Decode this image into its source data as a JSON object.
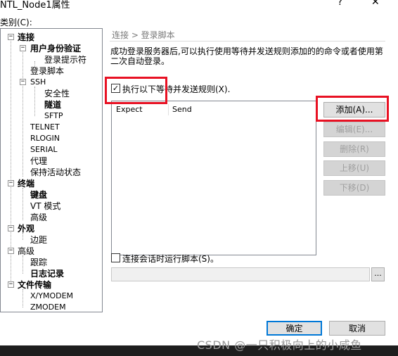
{
  "window": {
    "title": "NTL_Node1属性",
    "help_glyph": "?",
    "close_glyph": "✕"
  },
  "category_label": "类别(C):",
  "tree": {
    "connection": "连接",
    "auth": "用户身份验证",
    "login_prompt": "登录提示符",
    "login_script": "登录脚本",
    "ssh": "SSH",
    "security": "安全性",
    "tunnel": "隧道",
    "sftp": "SFTP",
    "telnet": "TELNET",
    "rlogin": "RLOGIN",
    "serial": "SERIAL",
    "proxy": "代理",
    "keepalive": "保持活动状态",
    "terminal": "终端",
    "keyboard": "键盘",
    "vt_mode": "VT 模式",
    "advanced_term": "高级",
    "appearance": "外观",
    "margin": "边距",
    "advanced": "高级",
    "trace": "跟踪",
    "logging": "日志记录",
    "file_transfer": "文件传输",
    "xymodem": "X/YMODEM",
    "zmodem": "ZMODEM"
  },
  "panel": {
    "header": "连接 > 登录脚本",
    "description": "成功登录服务器后,可以执行使用等待并发送规则添加的的命令或者使用第二次自动登录。",
    "rules_checkbox_label": "执行以下等待并发送规则(X).",
    "rules_checked": true,
    "col_expect": "Expect",
    "col_send": "Send",
    "add_button": "添加(A)...",
    "edit_button": "编辑(E)...",
    "delete_button": "删除(R)",
    "up_button": "上移(U)",
    "down_button": "下移(D)",
    "script_checkbox_label": "连接会话时运行脚本(S)。",
    "script_checked": false,
    "script_path_value": "",
    "browse_button": "..."
  },
  "footer": {
    "ok_button": "确定",
    "cancel_button": "取消"
  },
  "watermark": "CSDN @一只积极向上的小咸鱼",
  "colors": {
    "highlight_red": "#e81123",
    "default_button_border": "#0078d7"
  }
}
